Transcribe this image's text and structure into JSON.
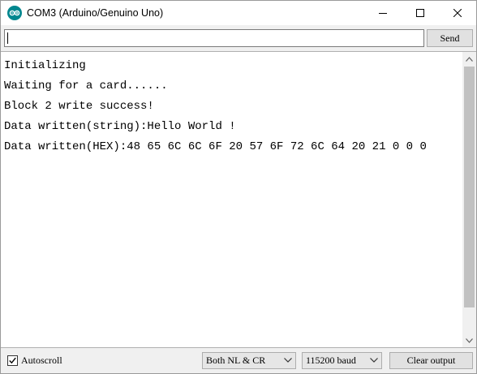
{
  "window": {
    "title": "COM3 (Arduino/Genuino Uno)"
  },
  "send_bar": {
    "input_value": "",
    "send_label": "Send"
  },
  "output": {
    "lines": [
      "Initializing",
      "Waiting for a card......",
      "Block 2 write success!",
      "Data written(string):Hello World !",
      "Data written(HEX):48 65 6C 6C 6F 20 57 6F 72 6C 64 20 21 0 0 0"
    ]
  },
  "bottom_bar": {
    "autoscroll_label": "Autoscroll",
    "autoscroll_checked": true,
    "line_ending": "Both NL & CR",
    "baud_rate": "115200 baud",
    "clear_label": "Clear output"
  },
  "colors": {
    "arduino_teal": "#00878f"
  },
  "icons": [
    "arduino-logo-icon",
    "minimize-icon",
    "maximize-icon",
    "close-icon",
    "scroll-up-icon",
    "scroll-down-icon",
    "chevron-down-icon",
    "checkmark-icon"
  ]
}
